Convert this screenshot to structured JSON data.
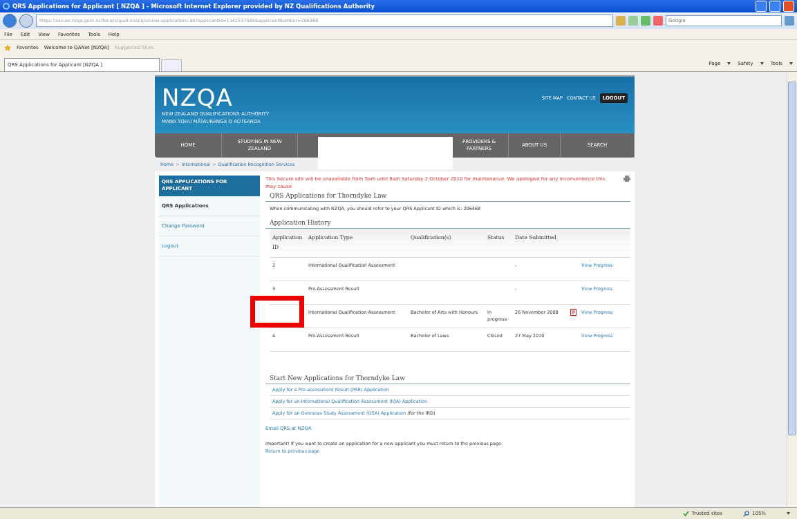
{
  "window": {
    "title": "QRS Applications for Applicant [ NZQA ] - Microsoft Internet Explorer provided by NZ Qualifications Authority"
  },
  "address_bar": {
    "url": "https://secure.nzqa.govt.nz/for-qrs/qual-eval/qrs/view-applications.do?applicantId=1342537588&applicantNumber=206468",
    "search_placeholder": "Google"
  },
  "menu": [
    "File",
    "Edit",
    "View",
    "Favorites",
    "Tools",
    "Help"
  ],
  "favorites_bar": {
    "label": "Favorites",
    "links": [
      "Welcome to QANet [NZQA]",
      "Suggested Sites"
    ]
  },
  "tabs": [
    {
      "label": "QRS Applications for Applicant [NZQA ]",
      "selected": true
    }
  ],
  "command_bar": [
    "Page",
    "Safety",
    "Tools"
  ],
  "site": {
    "logo": "NZQA",
    "logo_subtitle": [
      "NEW ZEALAND QUALIFICATIONS AUTHORITY",
      "MANA TOHU MĀTAURANGA O AOTEAROA"
    ],
    "top_links": [
      "SITE MAP",
      "CONTACT US"
    ],
    "logout": "LOGOUT",
    "nav": [
      {
        "kind": "link",
        "label": "HOME"
      },
      {
        "kind": "link",
        "label": "STUDYING IN NEW ZEALAND"
      },
      {
        "kind": "redacted"
      },
      {
        "kind": "link",
        "label": "PROVIDERS & PARTNERS"
      },
      {
        "kind": "link",
        "label": "ABOUT US"
      },
      {
        "kind": "link",
        "label": "SEARCH"
      }
    ],
    "breadcrumb": [
      "Home",
      "International",
      "Qualification Recognition Services"
    ],
    "breadcrumb_separator": ">"
  },
  "sidebar": {
    "title": "QRS APPLICATIONS FOR APPLICANT",
    "items": [
      {
        "label": "QRS Applications",
        "selected": true
      },
      {
        "label": "Change Password",
        "selected": false
      },
      {
        "label": "Logout",
        "selected": false
      }
    ]
  },
  "content": {
    "notice": "This Secure site will be unavailable from 5am until 8am Saturday 2 October 2010 for maintenance. We apologise for any inconvenience this may cause",
    "heading": "QRS Applications for Thorndyke Law",
    "info": "When communicating with NZQA, you should refer to your QRS Applicant ID which is: 206468",
    "history_heading": "Application History",
    "table": {
      "columns": [
        "Application ID",
        "Application Type",
        "Qualification(s)",
        "Status",
        "Date Submitted"
      ],
      "rows": [
        {
          "id": "2",
          "type": "International Qualification Assessment",
          "date": "-",
          "pdf": false,
          "link": "View Progress"
        },
        {
          "id": "3",
          "type": "Pre-Assessment Result",
          "date": "-",
          "pdf": false,
          "link": "View Progress"
        },
        {
          "type": "International Qualification Assessment",
          "qualification": "Bachelor of Arts with Honours",
          "status": "In progress",
          "date": "26 November 2008",
          "pdf": true,
          "link": "View Progress"
        },
        {
          "id": "4",
          "type": "Pre-Assessment Result",
          "qualification": "Bachelor of Laws",
          "status": "Closed",
          "date": "27 May 2010",
          "pdf": false,
          "link": "View Progress"
        }
      ]
    },
    "new_heading": "Start New Applications for Thorndyke Law",
    "new_links": [
      {
        "label": "Apply for a Pre-assessment Result (PAR) Application"
      },
      {
        "label": "Apply for an International Qualification Assessment (IQA) Application"
      },
      {
        "label": "Apply for an Overseas Study Assessment (OSA) Application",
        "note": "(for the IRD)"
      }
    ],
    "email_link": "Email QRS at NZQA",
    "important": "Important! If you want to create an application for a new applicant you must return to the previous page.",
    "return_link": "Return to previous page"
  },
  "status_bar": {
    "zone": "Trusted sites",
    "zoom": "105%"
  }
}
